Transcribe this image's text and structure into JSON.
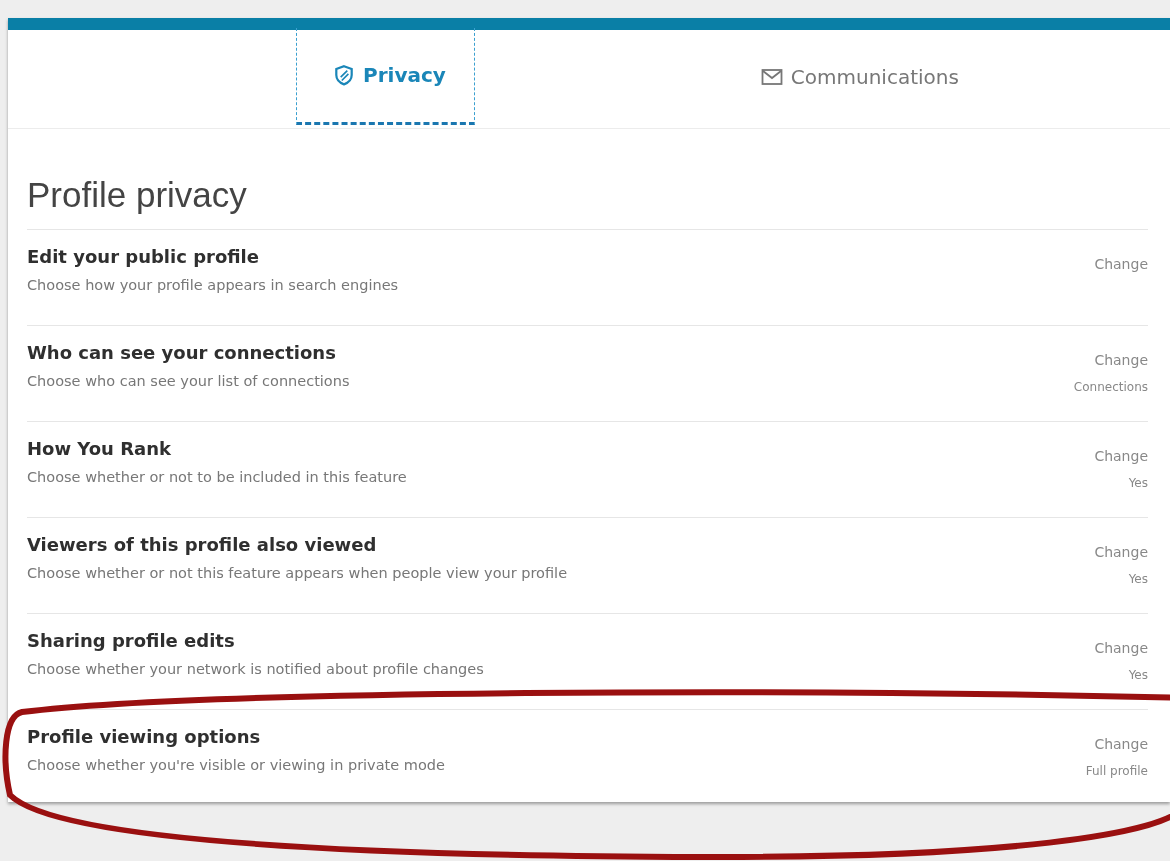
{
  "tabs": [
    {
      "label": "Privacy",
      "selected": true
    },
    {
      "label": "Communications",
      "selected": false
    }
  ],
  "section": {
    "title": "Profile privacy",
    "rows": [
      {
        "title": "Edit your public profile",
        "description": "Choose how your profile appears in search engines",
        "action": "Change"
      },
      {
        "title": "Who can see your connections",
        "description": "Choose who can see your list of connections",
        "action": "Change",
        "value": "Connections"
      },
      {
        "title": "How You Rank",
        "description": "Choose whether or not to be included in this feature",
        "action": "Change",
        "value": "Yes"
      },
      {
        "title": "Viewers of this profile also viewed",
        "description": "Choose whether or not this feature appears when people view your profile",
        "action": "Change",
        "value": "Yes"
      },
      {
        "title": "Sharing profile edits",
        "description": "Choose whether your network is notified about profile changes",
        "action": "Change",
        "value": "Yes"
      },
      {
        "title": "Profile viewing options",
        "description": "Choose whether you're visible or viewing in private mode",
        "action": "Change",
        "value": "Full profile"
      }
    ]
  }
}
